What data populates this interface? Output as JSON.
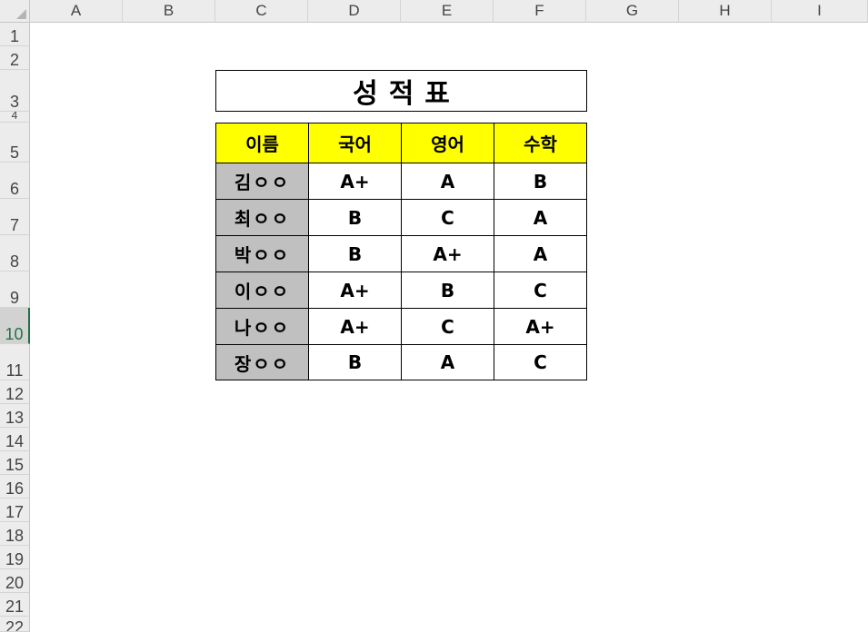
{
  "columns": [
    "A",
    "B",
    "C",
    "D",
    "E",
    "F",
    "G",
    "H",
    "I"
  ],
  "rows": [
    "1",
    "2",
    "3",
    "4",
    "5",
    "6",
    "7",
    "8",
    "9",
    "10",
    "11",
    "12",
    "13",
    "14",
    "15",
    "16",
    "17",
    "18",
    "19",
    "20",
    "21",
    "22"
  ],
  "active_row": "10",
  "sheet": {
    "title": "성적표",
    "headers": [
      "이름",
      "국어",
      "영어",
      "수학"
    ],
    "students": [
      {
        "name": "김ㅇㅇ",
        "korean": "A+",
        "english": "A",
        "math": "B"
      },
      {
        "name": "최ㅇㅇ",
        "korean": "B",
        "english": "C",
        "math": "A"
      },
      {
        "name": "박ㅇㅇ",
        "korean": "B",
        "english": "A+",
        "math": "A"
      },
      {
        "name": "이ㅇㅇ",
        "korean": "A+",
        "english": "B",
        "math": "C"
      },
      {
        "name": "나ㅇㅇ",
        "korean": "A+",
        "english": "C",
        "math": "A+"
      },
      {
        "name": "장ㅇㅇ",
        "korean": "B",
        "english": "A",
        "math": "C"
      }
    ]
  },
  "colors": {
    "header_fill": "#ffff00",
    "name_fill": "#c0c0c0",
    "active_accent": "#217346"
  }
}
